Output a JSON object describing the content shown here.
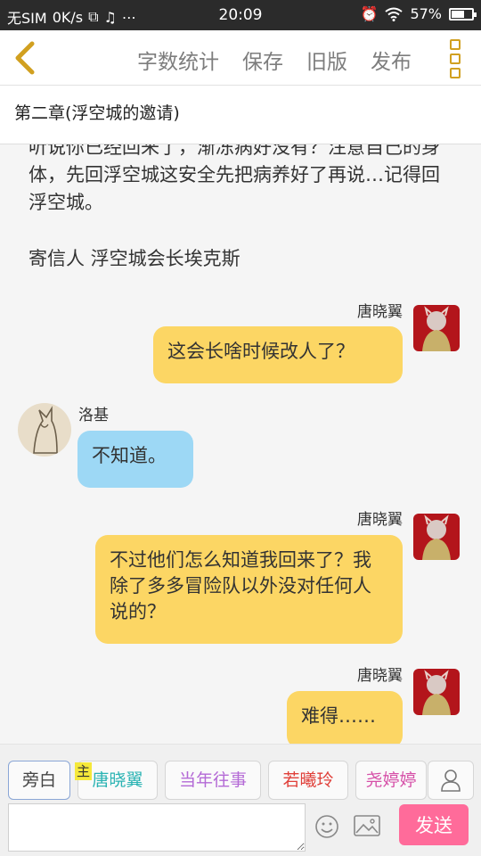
{
  "status_bar": {
    "carrier": "无SIM",
    "speed": "0K/s",
    "time": "20:09",
    "battery": "57%"
  },
  "toolbar": {
    "word_count": "字数统计",
    "save": "保存",
    "old_version": "旧版",
    "publish": "发布"
  },
  "chapter_title": "第二章(浮空城的邀请)",
  "narration": {
    "line1": "听说你已经回来了，渐冻病好没有？注意自己的身体，先回浮空城这安全先把病养好了再说…记得回浮空城。",
    "signature": "寄信人 浮空城会长埃克斯"
  },
  "messages": [
    {
      "speaker": "唐晓翼",
      "text": "这会长啥时候改人了？"
    },
    {
      "speaker": "洛基",
      "text": "不知道。"
    },
    {
      "speaker": "唐晓翼",
      "text": "不过他们怎么知道我回来了？我除了多多冒险队以外没对任何人说的？"
    },
    {
      "speaker": "唐晓翼",
      "text": "难得……"
    }
  ],
  "characters": {
    "narrator": "旁白",
    "main_badge": "主",
    "c1": "唐晓翼",
    "c2": "当年往事",
    "c3": "若曦玲",
    "c4": "尧婷婷"
  },
  "input": {
    "value": "",
    "send": "发送"
  },
  "icons": {
    "back": "chevron-left-icon",
    "more": "more-vertical-icon",
    "person": "person-icon",
    "emoji": "smiley-icon",
    "image": "image-icon"
  },
  "colors": {
    "accent": "#d1a020",
    "right_bubble": "#fcd664",
    "left_bubble": "#9dd8f5",
    "send_button": "#ff6b9a"
  }
}
